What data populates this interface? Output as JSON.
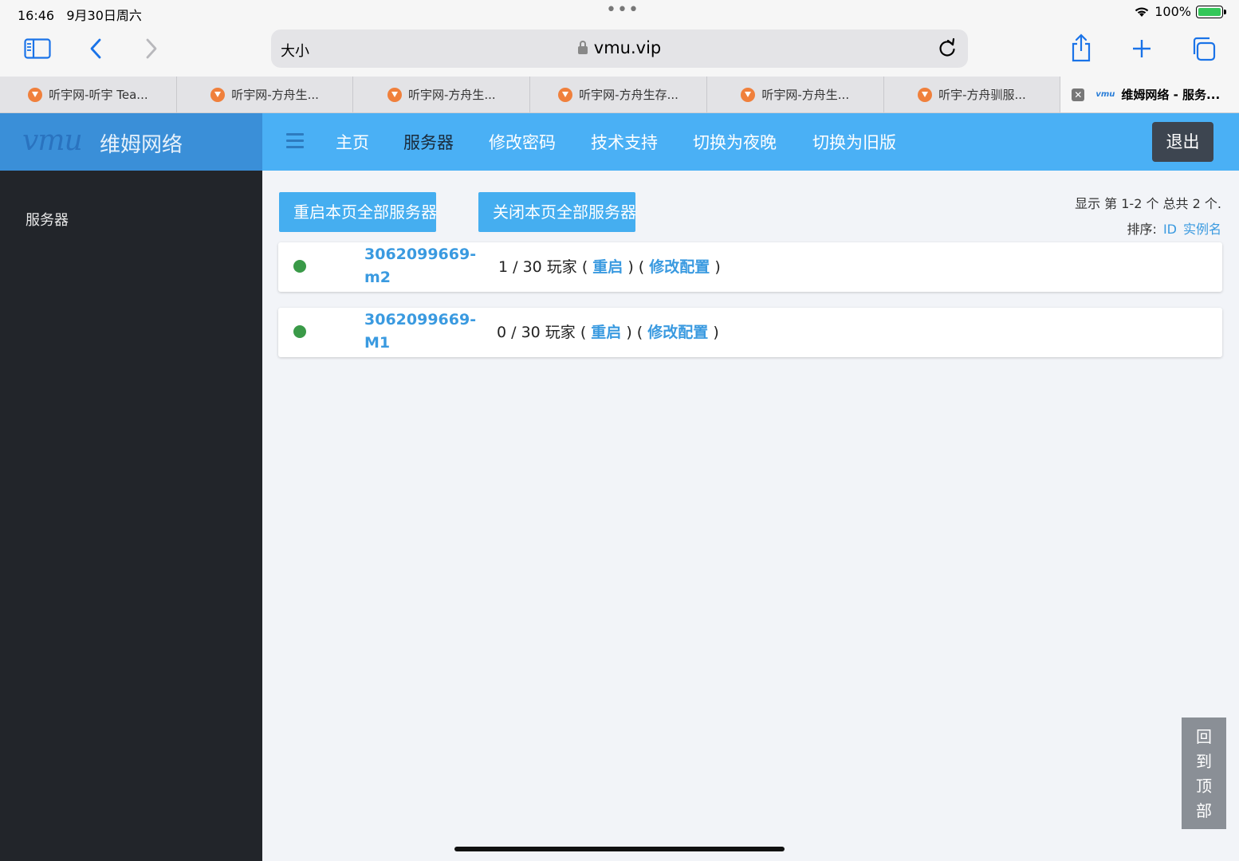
{
  "status_bar": {
    "time": "16:46",
    "date": "9月30日周六",
    "battery": "100%"
  },
  "browser": {
    "text_size_label": "大小",
    "url": "vmu.vip",
    "tabs": [
      {
        "label": "听宇网-听宇 Tea..."
      },
      {
        "label": "听宇网-方舟生..."
      },
      {
        "label": "听宇网-方舟生..."
      },
      {
        "label": "听宇网-方舟生存..."
      },
      {
        "label": "听宇网-方舟生..."
      },
      {
        "label": "听宇-方舟驯服..."
      },
      {
        "label": "维姆网络 - 服务...",
        "active": true
      }
    ]
  },
  "header": {
    "brand_logo": "vmu",
    "brand_name": "维姆网络",
    "nav": [
      {
        "label": "主页"
      },
      {
        "label": "服务器",
        "active": true
      },
      {
        "label": "修改密码"
      },
      {
        "label": "技术支持"
      },
      {
        "label": "切换为夜晚"
      },
      {
        "label": "切换为旧版"
      }
    ],
    "logout_label": "退出"
  },
  "sidebar": {
    "items": [
      {
        "label": "服务器"
      }
    ]
  },
  "main": {
    "restart_all_label": "重启本页全部服务器",
    "close_all_label": "关闭本页全部服务器",
    "summary": "显示 第 1-2 个 总共 2 个.",
    "sort_label": "排序:",
    "sort_id": "ID",
    "sort_name": "实例名",
    "servers": [
      {
        "id_line1": "3062099669-",
        "id_line2": "m2",
        "players": "1 / 30 玩家 (",
        "restart": "重启",
        "sep": ") (",
        "config": "修改配置",
        "end": ")",
        "status_color": "#3a9a48"
      },
      {
        "id_line1": "3062099669-",
        "id_line2": "M1",
        "players": "0 / 30 玩家 (",
        "restart": "重启",
        "sep": ") (",
        "config": "修改配置",
        "end": ")",
        "status_color": "#3a9a48"
      }
    ],
    "back_to_top": [
      "回",
      "到",
      "顶",
      "部"
    ]
  },
  "colors": {
    "accent": "#45aef0",
    "nav_bg": "#4ab0f5",
    "sidebar_bg": "#22252a",
    "online": "#3a9a48"
  }
}
